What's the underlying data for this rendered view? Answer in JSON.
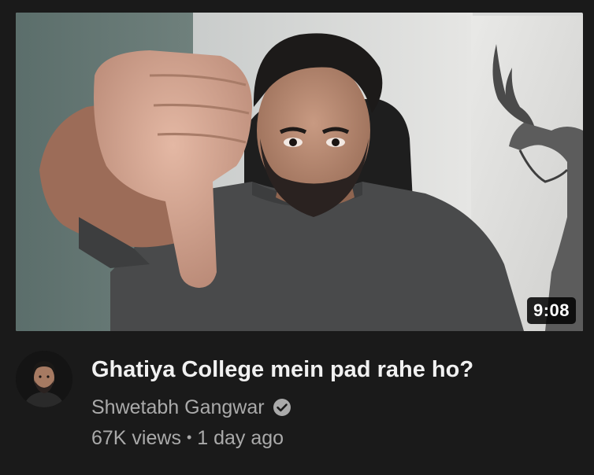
{
  "video": {
    "duration": "9:08",
    "title": "Ghatiya College mein pad rahe ho?",
    "channel": "Shwetabh Gangwar",
    "views": "67K views",
    "separator": "•",
    "age": "1 day ago",
    "thumbnail_icon": "thumbnail-image",
    "verified_icon": "verified-check-icon"
  },
  "colors": {
    "background": "#1a1a1a",
    "title": "#f1f1f1",
    "secondary_text": "#aaaaaa",
    "duration_badge": "#000000"
  }
}
